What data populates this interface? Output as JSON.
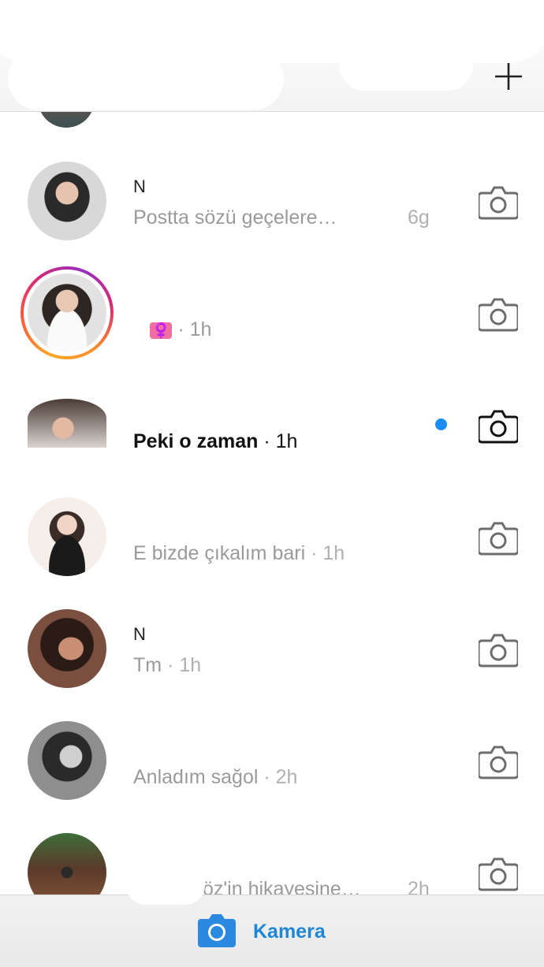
{
  "header": {
    "new_message_label": "+"
  },
  "threads": [
    {
      "name": "N",
      "preview": "Postta sözü geçelere…",
      "time": "6g",
      "unread": false,
      "story_ring": false
    },
    {
      "name": "",
      "preview": "♀️",
      "time": "· 1h",
      "unread": false,
      "story_ring": true
    },
    {
      "name": "",
      "preview": "Peki o zaman",
      "time": " · 1h",
      "unread": true,
      "story_ring": false
    },
    {
      "name": "",
      "preview": "E bizde çıkalım bari",
      "time": " · 1h",
      "unread": false,
      "story_ring": false
    },
    {
      "name": "N",
      "preview": "Tm",
      "time": " · 1h",
      "unread": false,
      "story_ring": false
    },
    {
      "name": "",
      "preview": "Anladım sağol",
      "time": " · 2h",
      "unread": false,
      "story_ring": false
    },
    {
      "name": "",
      "preview": "öz'in hikayesine…",
      "time": "2h",
      "unread": false,
      "story_ring": false
    }
  ],
  "bottom_bar": {
    "camera_label": "Kamera",
    "camera_icon": "camera-icon"
  },
  "colors": {
    "accent_blue": "#1f86d6",
    "unread_dot": "#1a8cf5",
    "muted_text": "#9a9a9a"
  }
}
